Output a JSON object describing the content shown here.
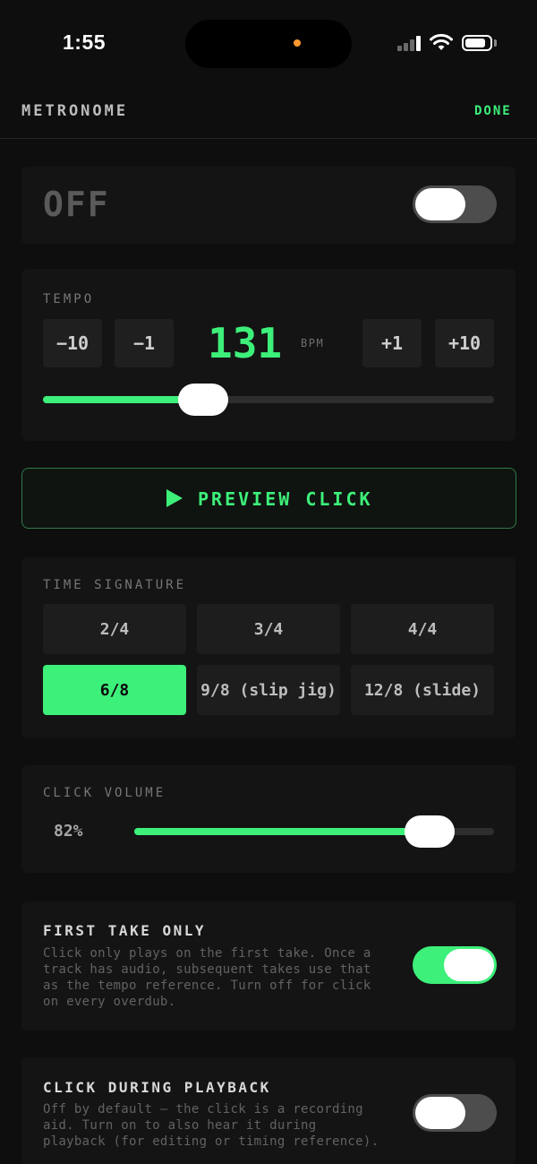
{
  "status_bar": {
    "time": "1:55"
  },
  "header": {
    "title": "METRONOME",
    "done_label": "DONE"
  },
  "power": {
    "state_label": "OFF",
    "enabled": false
  },
  "tempo": {
    "label": "TEMPO",
    "bpm": "131",
    "unit": "BPM",
    "buttons": [
      "−10",
      "−1",
      "+1",
      "+10"
    ],
    "slider_fraction": 0.355
  },
  "preview": {
    "label": "PREVIEW CLICK",
    "icon": "play-icon"
  },
  "time_signature": {
    "label": "TIME SIGNATURE",
    "options": [
      "2/4",
      "3/4",
      "4/4",
      "6/8",
      "9/8 (slip jig)",
      "12/8 (slide)"
    ],
    "selected": "6/8"
  },
  "click_volume": {
    "label": "CLICK VOLUME",
    "value": "82%",
    "fraction": 0.82
  },
  "first_take_only": {
    "title": "FIRST TAKE ONLY",
    "description_lines": [
      "Click only plays on the first take. Once a",
      "track has audio, subsequent takes use that",
      "as the tempo reference. Turn off for click",
      "on every overdub."
    ],
    "enabled": true
  },
  "click_during_playback": {
    "title": "CLICK DURING PLAYBACK",
    "description_lines": [
      "Off by default — the click is a recording",
      "aid. Turn on to also hear it during",
      "playback (for editing or timing reference)."
    ],
    "enabled": false
  },
  "colors": {
    "accent": "#3df07a",
    "background": "#0e0e0e",
    "card": "#141414"
  }
}
